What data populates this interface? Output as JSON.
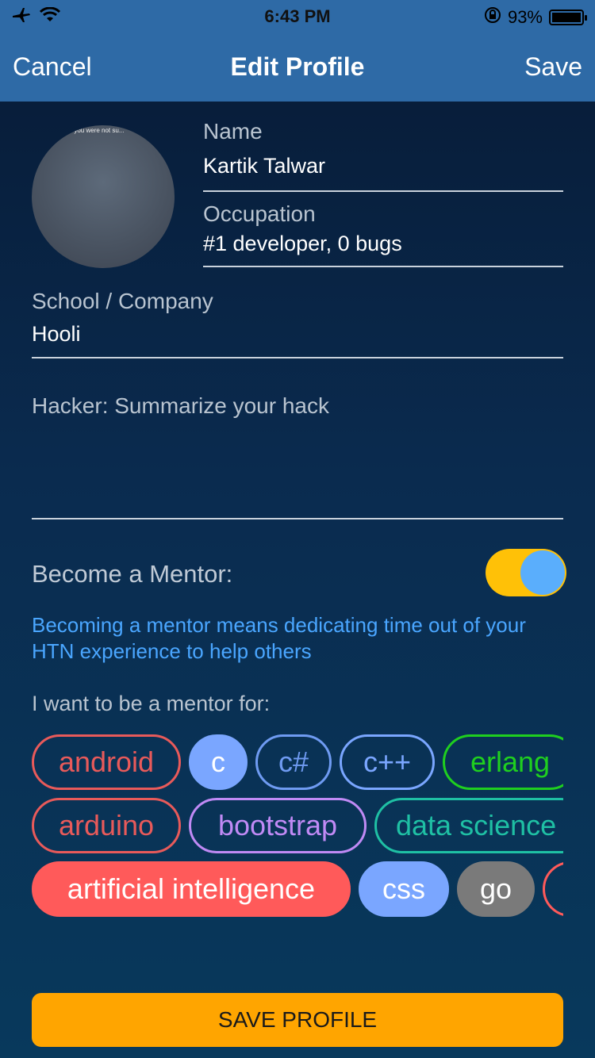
{
  "status_bar": {
    "time": "6:43 PM",
    "battery": "93%",
    "icons": [
      "airplane-icon",
      "wifi-icon",
      "rotation-lock-icon",
      "battery-icon"
    ]
  },
  "nav": {
    "cancel_label": "Cancel",
    "title": "Edit Profile",
    "save_label": "Save"
  },
  "avatar": {
    "caption": "...n you were not su..."
  },
  "form": {
    "name_label": "Name",
    "name_value": "Kartik Talwar",
    "occupation_label": "Occupation",
    "occupation_value": "#1 developer, 0 bugs",
    "school_label": "School / Company",
    "school_value": "Hooli",
    "hack_placeholder": "Hacker: Summarize your hack"
  },
  "mentor": {
    "label": "Become a Mentor:",
    "enabled": true,
    "note": "Becoming a mentor means dedicating time out of your HTN experience to help others",
    "want_label": "I want to be a mentor for:"
  },
  "tags": {
    "row1": [
      {
        "label": "android",
        "selected": false,
        "color": "#e85a5a"
      },
      {
        "label": "c",
        "selected": true,
        "color": "#7aa6ff"
      },
      {
        "label": "c#",
        "selected": false,
        "color": "#6f9bf2"
      },
      {
        "label": "c++",
        "selected": false,
        "color": "#7aa6ff"
      },
      {
        "label": "erlang",
        "selected": false,
        "color": "#1fcf1f"
      }
    ],
    "row2": [
      {
        "label": "arduino",
        "selected": false,
        "color": "#e85a5a"
      },
      {
        "label": "bootstrap",
        "selected": false,
        "color": "#c08af5"
      },
      {
        "label": "data science",
        "selected": false,
        "color": "#1fc0a4"
      }
    ],
    "row3": [
      {
        "label": "artificial intelligence",
        "selected": true,
        "color": "#ff5a5a"
      },
      {
        "label": "css",
        "selected": true,
        "color": "#7aa6ff"
      },
      {
        "label": "go",
        "selected": true,
        "color": "#7a7a7a"
      },
      {
        "label": "",
        "selected": false,
        "color": "#ff5a5a"
      }
    ]
  },
  "save_profile_label": "SAVE PROFILE",
  "colors": {
    "nav_bar": "#2e6aa6",
    "accent_orange": "#ffa500",
    "toggle_on": "#ffc107",
    "link_blue": "#4aa6ff"
  }
}
